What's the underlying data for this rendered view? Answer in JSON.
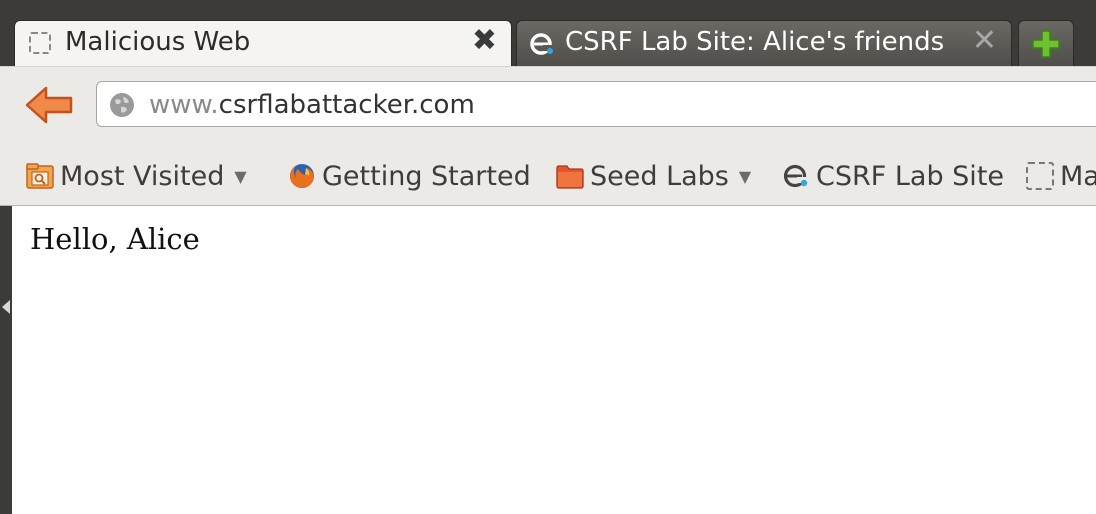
{
  "tabs": [
    {
      "title": "Malicious Web",
      "close_icon": "close-icon",
      "active": true
    },
    {
      "title": "CSRF Lab Site: Alice's friends",
      "close_icon": "close-icon",
      "active": false
    }
  ],
  "new_tab_icon": "plus-icon",
  "url": {
    "prefix": "www.",
    "domain": "csrflabattacker.com"
  },
  "bookmarks": [
    {
      "label": "Most Visited",
      "icon": "smart-folder-icon",
      "dropdown": true
    },
    {
      "label": "Getting Started",
      "icon": "firefox-icon",
      "dropdown": false
    },
    {
      "label": "Seed Labs",
      "icon": "folder-icon",
      "dropdown": true
    },
    {
      "label": "CSRF Lab Site",
      "icon": "elgg-icon",
      "dropdown": false
    },
    {
      "label": "Ma",
      "icon": "blank-page-icon",
      "dropdown": false
    }
  ],
  "page": {
    "greeting": "Hello, Alice"
  },
  "colors": {
    "accent_orange": "#e05a1a",
    "new_tab_green": "#6fc22f"
  }
}
